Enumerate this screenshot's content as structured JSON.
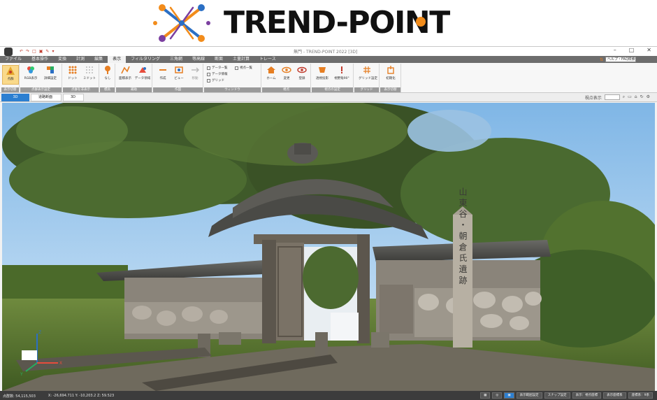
{
  "brand": {
    "name": "TREND-POINT",
    "colors": {
      "orange": "#f28c1b",
      "blue": "#2b6fc4",
      "purple": "#7b3fa0",
      "text": "#111111"
    }
  },
  "titlebar": {
    "app_icon": "trend-point-app-icon",
    "window_title": "無門 - TREND-POINT 2022 [3D]",
    "quick_access": [
      "↶",
      "↷",
      "□",
      "▣",
      "✎",
      "▾"
    ],
    "controls": [
      "–",
      "□",
      "✕"
    ]
  },
  "menu": {
    "tabs": [
      "ファイル",
      "基本操作",
      "変換",
      "計測",
      "編集",
      "表示",
      "フィルタリング",
      "三角網",
      "等高線",
      "断面",
      "土量計算",
      "トレース"
    ],
    "active_tab": "表示",
    "help_search": "ヘルプ・FAQ検索"
  },
  "ribbon": {
    "groups": [
      {
        "label": "表示切替",
        "buttons": [
          "点群"
        ]
      },
      {
        "label": "点群表示設定",
        "buttons": [
          "RGB表示",
          "詳細設定"
        ]
      },
      {
        "label": "点群を非表示",
        "buttons": [
          "ドット",
          "ミドット"
        ]
      },
      {
        "label": "標高",
        "buttons": [
          "なし"
        ]
      },
      {
        "label": "補助",
        "buttons": [
          "面積表示",
          "データ領域"
        ]
      },
      {
        "label": "作図",
        "buttons": [
          "作成",
          "ビュー",
          "移動"
        ]
      },
      {
        "label": "ウィンドウ",
        "checks": [
          "データ一覧",
          "データ情報",
          "グリッド",
          "視点一覧"
        ]
      },
      {
        "label": "視点",
        "buttons": [
          "ホーム",
          "変更",
          "登録"
        ]
      },
      {
        "label": "視点の設定",
        "buttons": [
          "透視投影",
          "視野角90°"
        ]
      },
      {
        "label": "グリッド",
        "buttons": [
          "グリッド設定"
        ]
      },
      {
        "label": "表示切替",
        "buttons": [
          "初期化"
        ]
      }
    ]
  },
  "view_tabs": {
    "tabs": [
      "3D",
      "道路断面",
      "3D"
    ],
    "active": "3D",
    "search_label": "視点表示",
    "toolbar_icons": [
      "zoom-icon",
      "fit-icon",
      "home-icon",
      "rotate-icon",
      "settings-icon"
    ]
  },
  "viewport": {
    "content": "3d-point-cloud-temple-gate",
    "stone_pillar_text": "山 東 谷 ・ 朝 倉 氏 遺 跡",
    "axis_gizmo": [
      "X",
      "Y",
      "Z"
    ]
  },
  "statusbar": {
    "point_count": "点群数: 54,115,503",
    "coords": "X: -26,694.711  Y: -10,203.2  Z: 59.523",
    "buttons": [
      "表示範囲設定",
      "スナップ設定",
      "表示：視点座標",
      "表示座標系",
      "座標系：9系"
    ],
    "icons": [
      "grid-toggle-icon",
      "snap-icon",
      "view-icon"
    ]
  }
}
